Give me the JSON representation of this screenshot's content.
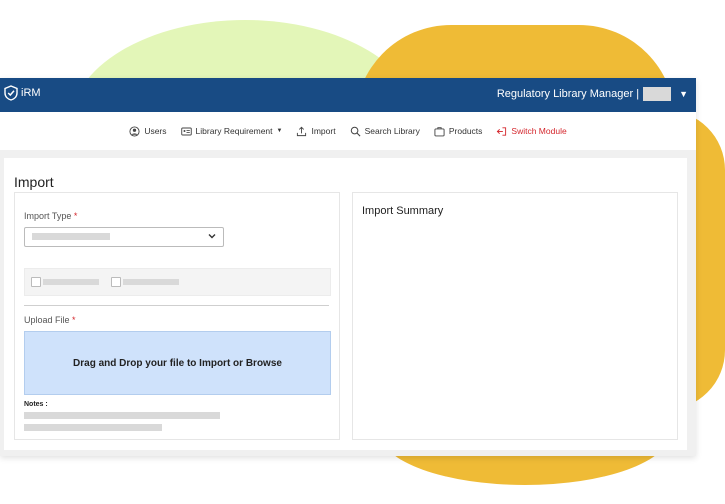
{
  "header": {
    "app_name": "iRM",
    "user_label": "Regulatory Library Manager |"
  },
  "nav": {
    "items": [
      {
        "label": "Users",
        "icon": "user-icon"
      },
      {
        "label": "Library Requirement",
        "icon": "id-card-icon"
      },
      {
        "label": "Import",
        "icon": "upload-icon"
      },
      {
        "label": "Search Library",
        "icon": "search-icon"
      },
      {
        "label": "Products",
        "icon": "briefcase-icon"
      },
      {
        "label": "Switch Module",
        "icon": "switch-icon"
      }
    ]
  },
  "page": {
    "title": "Import",
    "import_type_label": "Import Type",
    "required_mark": "*",
    "upload_file_label": "Upload File",
    "drop_zone_text": "Drag and Drop your file to Import or Browse",
    "notes_label": "Notes :",
    "summary_title": "Import Summary"
  },
  "colors": {
    "header_bg": "#184b84",
    "switch_module": "#d4262c",
    "drop_zone_bg": "#cfe2fb"
  }
}
